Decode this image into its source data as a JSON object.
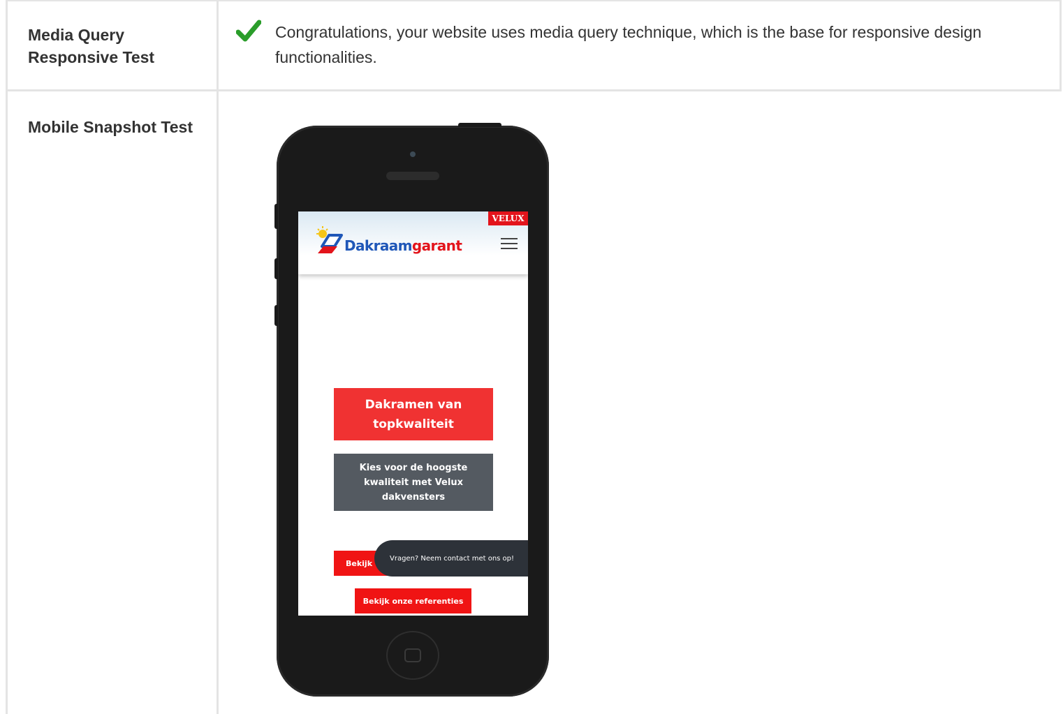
{
  "rows": [
    {
      "label": "Media Query Responsive Test",
      "result_icon": "check-icon",
      "result_text": "Congratulations, your website uses media query technique, which is the base for responsive design functionalities."
    },
    {
      "label": "Mobile Snapshot Test"
    }
  ],
  "snapshot": {
    "brand_badge": "VELUX",
    "logo_part1": "Dakraam",
    "logo_part2": "garant",
    "hero_title": "Dakramen van topkwaliteit",
    "hero_subtitle": "Kies voor de hoogste kwaliteit met Velux dakvensters",
    "button_partial": "Bekijk V",
    "chat_text": "Vragen? Neem contact met ons op!",
    "button_references": "Bekijk onze referenties"
  },
  "colors": {
    "check": "#2a9d2a",
    "accent_red": "#e3141b",
    "logo_blue": "#1f57b8",
    "grey_panel": "#545a61",
    "chat_bg": "#2d3239"
  }
}
